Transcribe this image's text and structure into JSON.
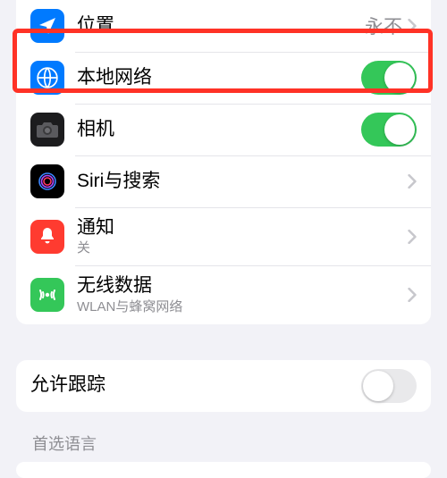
{
  "rows": {
    "location": {
      "label": "位置",
      "value": "永不"
    },
    "localNetwork": {
      "label": "本地网络"
    },
    "camera": {
      "label": "相机"
    },
    "siri": {
      "label": "Siri与搜索"
    },
    "notifications": {
      "label": "通知",
      "sublabel": "关"
    },
    "wireless": {
      "label": "无线数据",
      "sublabel": "WLAN与蜂窝网络"
    }
  },
  "tracking": {
    "label": "允许跟踪"
  },
  "sections": {
    "preferredLanguage": "首选语言"
  },
  "toggles": {
    "localNetwork": true,
    "camera": true,
    "tracking": false
  }
}
